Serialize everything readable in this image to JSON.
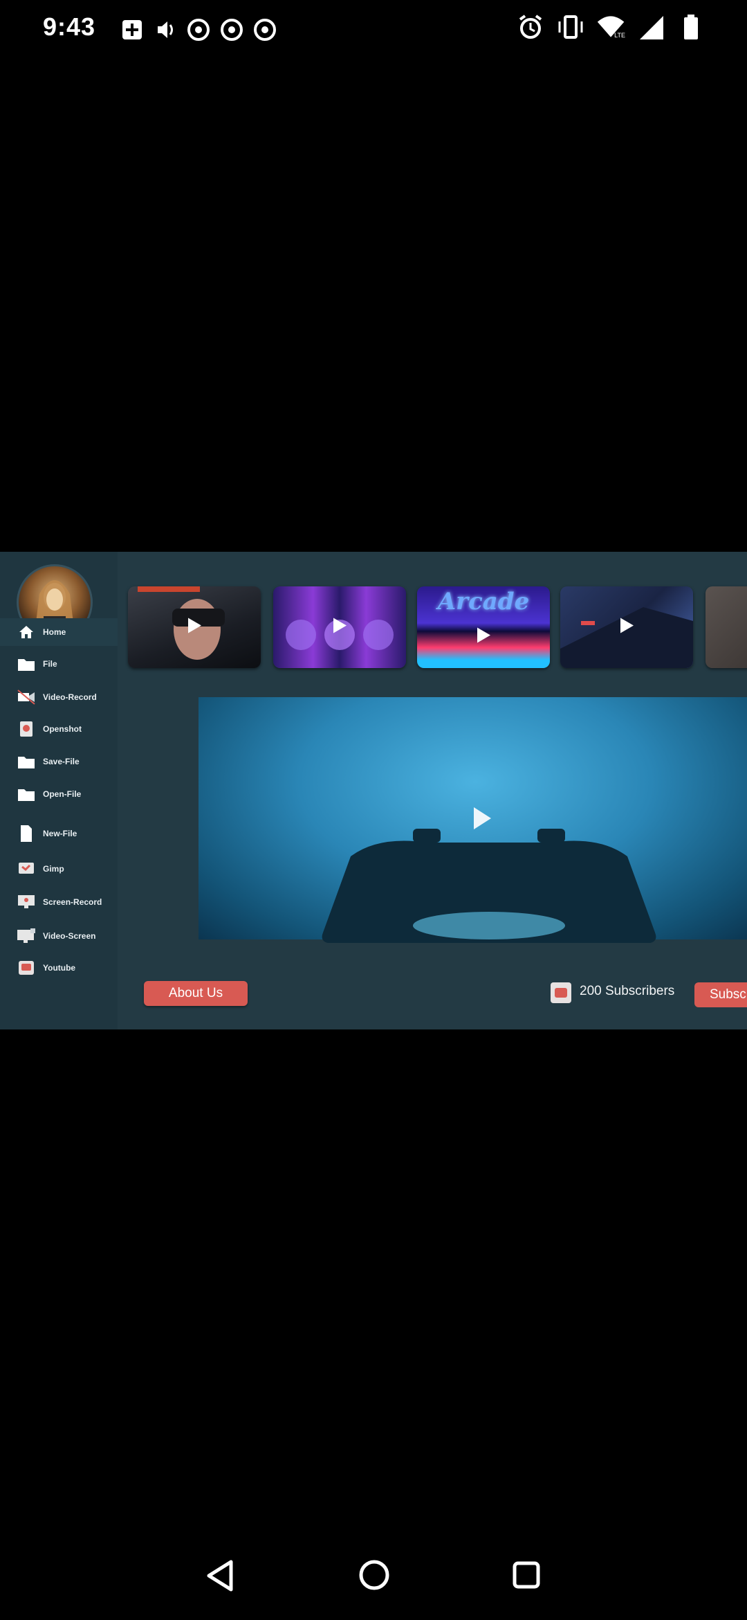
{
  "status_bar": {
    "time": "9:43",
    "left_icons": [
      "notification-icon",
      "sound-icon",
      "chrome-icon",
      "chrome-icon",
      "chrome-icon"
    ],
    "right_icons": [
      "alarm-icon",
      "vibrate-icon",
      "wifi-icon",
      "signal-icon",
      "battery-icon"
    ],
    "network_label": "LTE"
  },
  "sidebar": {
    "items": [
      {
        "label": "Home",
        "icon": "home-icon"
      },
      {
        "label": "File",
        "icon": "folder-icon"
      },
      {
        "label": "Video-Record",
        "icon": "video-record-icon"
      },
      {
        "label": "Openshot",
        "icon": "openshot-icon"
      },
      {
        "label": "Save-File",
        "icon": "folder-icon"
      },
      {
        "label": "Open-File",
        "icon": "folder-icon"
      },
      {
        "label": "New-File",
        "icon": "file-icon"
      },
      {
        "label": "Gimp",
        "icon": "gimp-icon"
      },
      {
        "label": "Screen-Record",
        "icon": "screen-record-icon"
      },
      {
        "label": "Video-Screen",
        "icon": "video-screen-icon"
      },
      {
        "label": "Youtube",
        "icon": "youtube-icon"
      }
    ]
  },
  "thumbnails": {
    "arcade_title": "Arcade"
  },
  "footer": {
    "about_label": "About Us",
    "subscribers_text": "200 Subscribers",
    "subscribe_label": "Subsc"
  },
  "colors": {
    "accent": "#d85a53",
    "panel": "#233a44",
    "sidebar": "#1f3640"
  }
}
